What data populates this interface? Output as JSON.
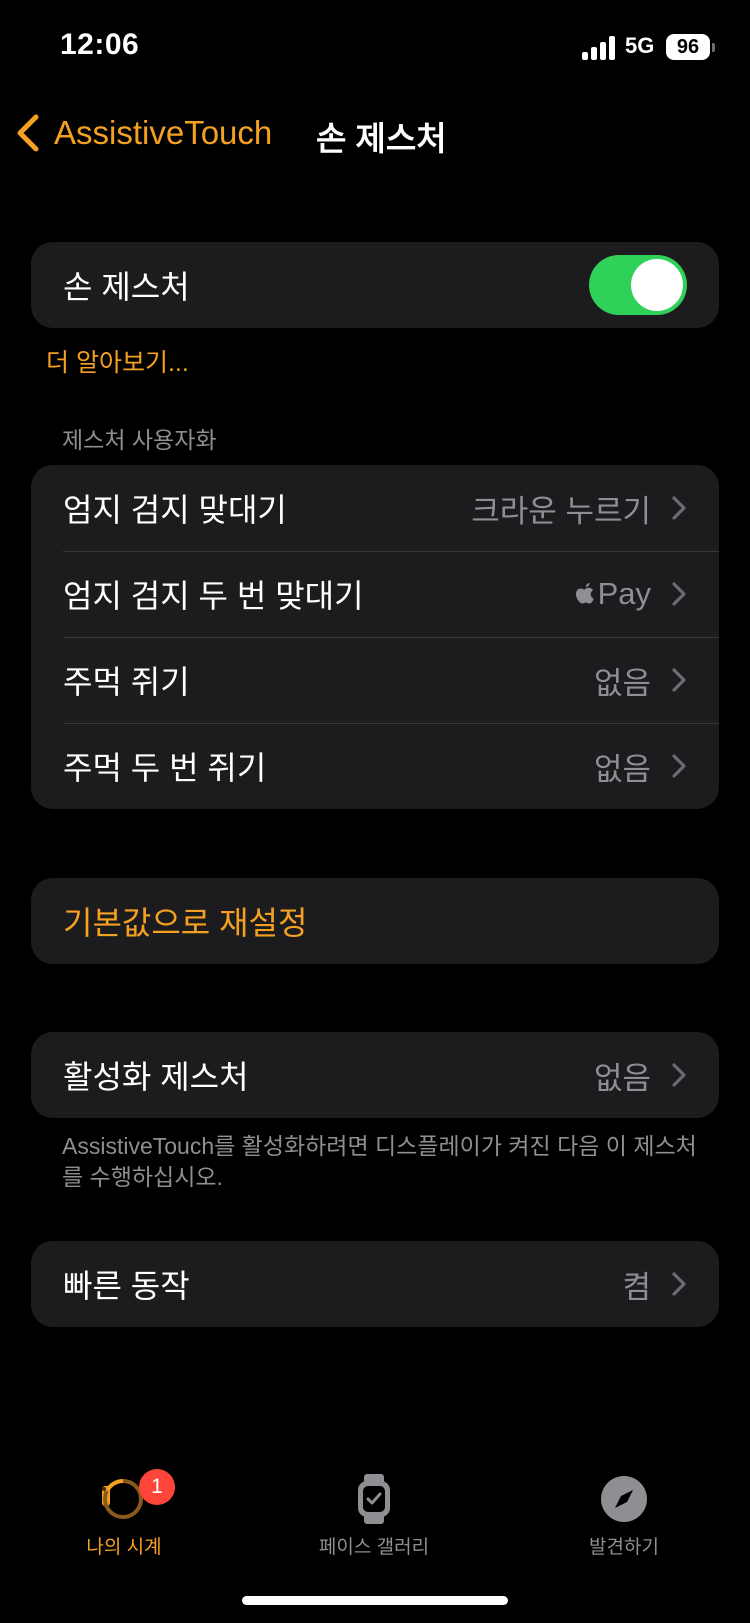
{
  "status_bar": {
    "time": "12:06",
    "network": "5G",
    "battery": "96"
  },
  "nav": {
    "back_label": "AssistiveTouch",
    "title": "손 제스처"
  },
  "hand_gesture": {
    "label": "손 제스처",
    "enabled": true
  },
  "learn_more": "더 알아보기...",
  "customize": {
    "header": "제스처 사용자화",
    "rows": [
      {
        "label": "엄지 검지 맞대기",
        "value": "크라운 누르기"
      },
      {
        "label": "엄지 검지 두 번 맞대기",
        "value": "Pay",
        "value_icon": "apple-logo-icon"
      },
      {
        "label": "주먹 쥐기",
        "value": "없음"
      },
      {
        "label": "주먹 두 번 쥐기",
        "value": "없음"
      }
    ]
  },
  "reset": {
    "label": "기본값으로 재설정"
  },
  "activation": {
    "label": "활성화 제스처",
    "value": "없음",
    "footer": "AssistiveTouch를 활성화하려면 디스플레이가 켜진 다음 이 제스처를 수행하십시오."
  },
  "quick_actions": {
    "label": "빠른 동작",
    "value": "켬"
  },
  "tab_bar": {
    "tabs": [
      {
        "label": "나의 시계",
        "icon": "watch-icon",
        "active": true,
        "badge": "1"
      },
      {
        "label": "페이스 갤러리",
        "icon": "watch-face-gallery-icon",
        "active": false
      },
      {
        "label": "발견하기",
        "icon": "compass-icon",
        "active": false
      }
    ]
  },
  "colors": {
    "accent": "#f4a020",
    "toggle_on": "#30d158",
    "cell_bg": "#1c1c1e",
    "secondary_text": "#8e8e93",
    "badge": "#ff453a"
  }
}
